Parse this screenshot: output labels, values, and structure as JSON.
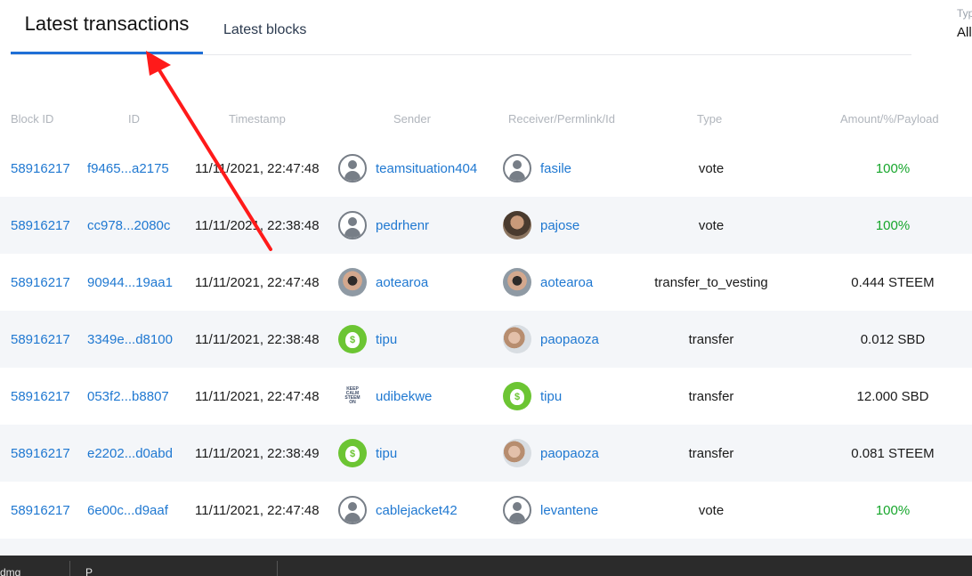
{
  "tabs": {
    "active_label": "Latest transactions",
    "inactive_label": "Latest blocks"
  },
  "type_filter": {
    "label": "Typ",
    "value": "All"
  },
  "columns": [
    "Block ID",
    "ID",
    "Timestamp",
    "Sender",
    "Receiver/Permlink/Id",
    "Type",
    "Amount/%/Payload"
  ],
  "rows": [
    {
      "block": "58916217",
      "id": "f9465...a2175",
      "ts": "11/11/2021, 22:47:48",
      "sender": "teamsituation404",
      "sender_avatar": "default-avatar-icon",
      "receiver": "fasile",
      "receiver_avatar": "default-avatar-icon",
      "type": "vote",
      "amount": "100%",
      "amount_kind": "pct"
    },
    {
      "block": "58916217",
      "id": "cc978...2080c",
      "ts": "11/11/2021, 22:38:48",
      "sender": "pedrhenr",
      "sender_avatar": "default-avatar-icon",
      "receiver": "pajose",
      "receiver_avatar": "photo-avatar",
      "type": "vote",
      "amount": "100%",
      "amount_kind": "pct"
    },
    {
      "block": "58916217",
      "id": "90944...19aa1",
      "ts": "11/11/2021, 22:47:48",
      "sender": "aotearoa",
      "sender_avatar": "sunglasses-photo-avatar",
      "receiver": "aotearoa",
      "receiver_avatar": "sunglasses-photo-avatar",
      "type": "transfer_to_vesting",
      "amount": "0.444 STEEM",
      "amount_kind": "plain"
    },
    {
      "block": "58916217",
      "id": "3349e...d8100",
      "ts": "11/11/2021, 22:38:48",
      "sender": "tipu",
      "sender_avatar": "money-bag-icon",
      "receiver": "paopaoza",
      "receiver_avatar": "couple-photo-avatar",
      "type": "transfer",
      "amount": "0.012 SBD",
      "amount_kind": "plain"
    },
    {
      "block": "58916217",
      "id": "053f2...b8807",
      "ts": "11/11/2021, 22:47:48",
      "sender": "udibekwe",
      "sender_avatar": "keep-calm-steem-on-avatar",
      "receiver": "tipu",
      "receiver_avatar": "money-bag-icon",
      "type": "transfer",
      "amount": "12.000 SBD",
      "amount_kind": "plain"
    },
    {
      "block": "58916217",
      "id": "e2202...d0abd",
      "ts": "11/11/2021, 22:38:49",
      "sender": "tipu",
      "sender_avatar": "money-bag-icon",
      "receiver": "paopaoza",
      "receiver_avatar": "couple-photo-avatar",
      "type": "transfer",
      "amount": "0.081 STEEM",
      "amount_kind": "plain"
    },
    {
      "block": "58916217",
      "id": "6e00c...d9aaf",
      "ts": "11/11/2021, 22:47:48",
      "sender": "cablejacket42",
      "sender_avatar": "default-avatar-icon",
      "receiver": "levantene",
      "receiver_avatar": "default-avatar-icon",
      "type": "vote",
      "amount": "100%",
      "amount_kind": "pct"
    }
  ],
  "avatar_text": {
    "keep_calm": [
      "KEEP",
      "CALM",
      "STEEM",
      "ON"
    ],
    "money_bag": "$"
  },
  "dock": {
    "item1": "dmg",
    "item2": "P"
  },
  "colors": {
    "link": "#1f78d1",
    "percent": "#17a62c",
    "active_tab_underline": "#1f6fd6",
    "annotation_arrow": "#ff1a1a",
    "alt_row": "#f4f6f9"
  }
}
